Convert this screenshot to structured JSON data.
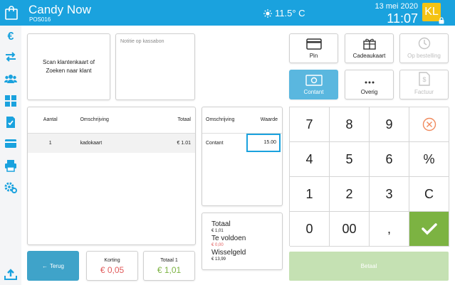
{
  "header": {
    "app_title": "Candy Now",
    "store_code": "POS016",
    "weather": "11.5° C",
    "date": "13 mei 2020",
    "time": "11:07",
    "user_initials": "KL",
    "accent_color": "#1aa2de"
  },
  "sidebar": {
    "items": [
      {
        "icon": "euro-icon",
        "glyph": "€"
      },
      {
        "icon": "transfer-icon"
      },
      {
        "icon": "customers-icon"
      },
      {
        "icon": "dashboard-icon"
      },
      {
        "icon": "document-check-icon"
      },
      {
        "icon": "card-icon"
      },
      {
        "icon": "printer-icon"
      },
      {
        "icon": "settings-icon"
      },
      {
        "icon": "upload-icon"
      }
    ]
  },
  "customer": {
    "scan_text": "Scan klantenkaart of Zoeken naar klant"
  },
  "note": {
    "placeholder": "Notitie op kassabon"
  },
  "items_table": {
    "headers": {
      "qty": "Aantal",
      "desc": "Omschrijving",
      "total": "Totaal"
    },
    "rows": [
      {
        "qty": "1",
        "desc": "kadokaart",
        "total": "€ 1.01"
      }
    ]
  },
  "payment_table": {
    "headers": {
      "desc": "Omschrijving",
      "value": "Waarde"
    },
    "rows": [
      {
        "desc": "Contant",
        "value": "15.00"
      }
    ]
  },
  "totals": {
    "total_label": "Totaal",
    "total_value": "€ 1,01",
    "due_label": "Te voldoen",
    "due_value": "€ 0,00",
    "change_label": "Wisselgeld",
    "change_value": "€ 13,99"
  },
  "footer": {
    "back_label": "Terug",
    "discount_label": "Korting",
    "discount_value": "€ 0,05",
    "total1_label": "Totaal 1",
    "total1_value": "€ 1,01"
  },
  "payment_methods": {
    "pin": "Pin",
    "giftcard": "Cadeaukaart",
    "on_order": "Op bestelling",
    "cash": "Contant",
    "other": "Overig",
    "invoice": "Factuur"
  },
  "keypad": {
    "k7": "7",
    "k8": "8",
    "k9": "9",
    "k4": "4",
    "k5": "5",
    "k6": "6",
    "percent": "%",
    "k1": "1",
    "k2": "2",
    "k3": "3",
    "clear": "C",
    "k0": "0",
    "k00": "00",
    "comma": ","
  },
  "pay_button": "Betaal",
  "colors": {
    "ok_green": "#7cb342",
    "pay_disabled": "#c5e1b3",
    "discount_red": "#e05a5a"
  }
}
